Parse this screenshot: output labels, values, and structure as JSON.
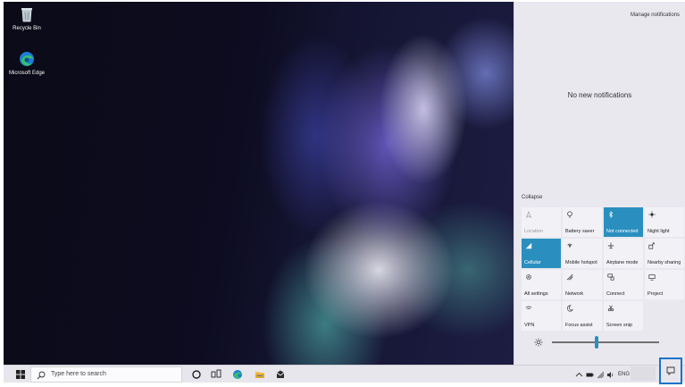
{
  "desktop": {
    "icons": [
      {
        "label": "Recycle Bin",
        "icon": "recycle-bin-icon"
      },
      {
        "label": "Microsoft Edge",
        "icon": "edge-icon"
      }
    ]
  },
  "action_center": {
    "manage_label": "Manage notifications",
    "empty_label": "No new notifications",
    "collapse_label": "Collapse",
    "accent": "#2a8fbf",
    "tiles": [
      {
        "label": "Location",
        "icon": "location-icon",
        "active": false,
        "dim": true
      },
      {
        "label": "Battery saver",
        "icon": "battery-saver-icon",
        "active": false
      },
      {
        "label": "Not connected",
        "icon": "bluetooth-icon",
        "active": true
      },
      {
        "label": "Night light",
        "icon": "night-light-icon",
        "active": false
      },
      {
        "label": "Cellular",
        "icon": "cellular-icon",
        "active": true
      },
      {
        "label": "Mobile hotspot",
        "icon": "mobile-hotspot-icon",
        "active": false
      },
      {
        "label": "Airplane mode",
        "icon": "airplane-icon",
        "active": false
      },
      {
        "label": "Nearby sharing",
        "icon": "nearby-sharing-icon",
        "active": false
      },
      {
        "label": "All settings",
        "icon": "gear-icon",
        "active": false
      },
      {
        "label": "Network",
        "icon": "network-icon",
        "active": false
      },
      {
        "label": "Connect",
        "icon": "connect-icon",
        "active": false
      },
      {
        "label": "Project",
        "icon": "project-icon",
        "active": false
      },
      {
        "label": "VPN",
        "icon": "vpn-icon",
        "active": false
      },
      {
        "label": "Focus assist",
        "icon": "focus-assist-icon",
        "active": false
      },
      {
        "label": "Screen snip",
        "icon": "screen-snip-icon",
        "active": false
      }
    ],
    "brightness_level": 0.42
  },
  "taskbar": {
    "search_placeholder": "Type here to search",
    "pinned": [
      "cortana-icon",
      "task-view-icon",
      "edge-icon",
      "file-explorer-icon",
      "mail-icon"
    ],
    "tray": {
      "language": "ENG"
    }
  }
}
